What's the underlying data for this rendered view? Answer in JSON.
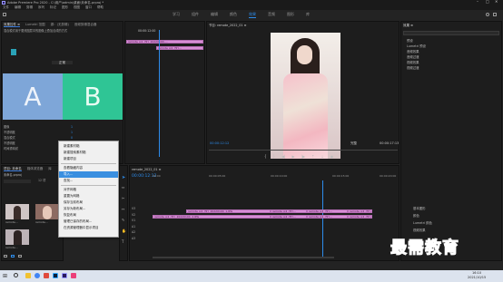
{
  "app_title": "Adobe Premiere Pro 2020 - C:\\用户\\admin\\桌面\\未命名.prproj *",
  "menu_bar": [
    "文件",
    "编辑",
    "剪辑",
    "序列",
    "标记",
    "图形",
    "视图",
    "窗口",
    "帮助"
  ],
  "workspaces": [
    "学习",
    "组件",
    "编辑",
    "颜色",
    "效果",
    "音频",
    "图形",
    "库"
  ],
  "workspace_active": "效果",
  "source_panel": {
    "tabs": [
      "效果控件 ≡",
      "Lumetri 范围",
      "源：(无剪辑)",
      "音频剪辑混合器"
    ],
    "notice": "混合模式用于更改图层中的图像上叠加合成的方式"
  },
  "essential_graphics": {
    "values": [
      "1",
      "1",
      "0",
      "60",
      "0"
    ],
    "labels": [
      "图像",
      "不透明度",
      "混合模式",
      "不透明度",
      "时间重映射"
    ],
    "blend_mode": "正常"
  },
  "overlay_a": "A",
  "overlay_b": "B",
  "program_monitor": {
    "title": "节目: remote_2022_01 ≡",
    "timecode_left": "00:00:12:12",
    "fit_label": "完整",
    "timecode_right": "00:00:17:13"
  },
  "source_timeline": {
    "timecode": "00:00:12:00",
    "clips": [
      "remote_p4_(文)_20220104....",
      "remote_p4_(文)..."
    ]
  },
  "project_panel": {
    "tabs": [
      "项目: 未命名",
      "媒体浏览器",
      "库"
    ],
    "search_placeholder": "",
    "items_label": "未命名.prproj",
    "item_count": "12 项",
    "thumbnails": [
      "remote...",
      "remote...",
      "remote...",
      "remote...",
      "remote..."
    ]
  },
  "context_menu": {
    "items": [
      "新建素材箱",
      "新建搜索素材箱",
      "新建项目",
      "查看隐藏内容",
      "导入...",
      "查找...",
      "对齐网格",
      "重置为网格",
      "保存当前布局",
      "另存为新布局...",
      "恢复布局",
      "管理已保存的布局...",
      "在资源管理器中显示项目"
    ],
    "highlighted": "导入..."
  },
  "timeline": {
    "title": "remote_2022_01 ≡",
    "timecode": "00:00:12:12",
    "ruler": [
      "00:00",
      "00:00:05:00",
      "00:00:10:00",
      "00:00:15:00",
      "00:00:20:00"
    ],
    "tracks": [
      "V3",
      "V2",
      "V1",
      "A1",
      "A2",
      "A3"
    ],
    "clips": [
      "remote_p4_(文)_20220104_1.JPG",
      "remote_p4_(文)...",
      "remote_p4_(文)...",
      "remote_p4_(文)...",
      "remote_p4_(文)_20220104_2.JPG",
      "remote_p4_(文)...",
      "remote_p4_(文)...",
      "remote_p4_(文)..."
    ]
  },
  "effects_panel": {
    "title": "效果 ≡",
    "tree": [
      "预设",
      "Lumetri 预设",
      "音频效果",
      "音频过渡",
      "视频效果",
      "视频过渡"
    ],
    "lower": [
      "基本图形",
      "颜色",
      "Lumetri 颜色",
      "视频效果"
    ]
  },
  "watermark": "最需教育",
  "taskbar": {
    "clock": "16:10",
    "date": "2021/10/15"
  },
  "colors": {
    "accent_blue": "#2d8ceb",
    "clip_pink": "#d88fd6",
    "overlay_a": "#7ea6d8",
    "overlay_b": "#2fc595"
  }
}
